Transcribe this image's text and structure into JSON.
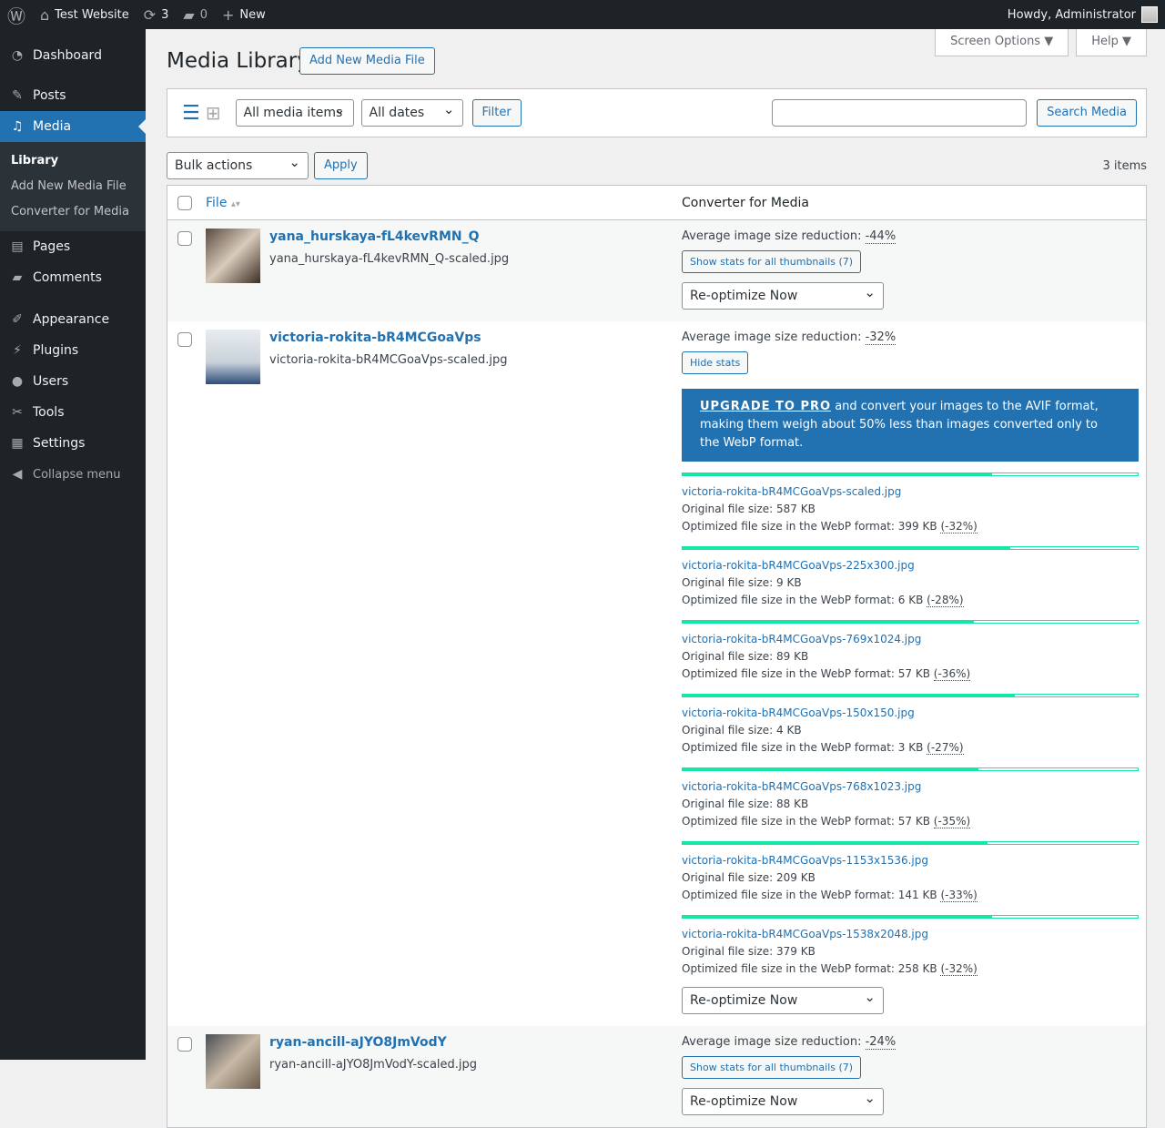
{
  "adminbar": {
    "site": "Test Website",
    "updates": "3",
    "comments": "0",
    "new": "New",
    "howdy": "Howdy, Administrator"
  },
  "menu": {
    "dashboard": "Dashboard",
    "posts": "Posts",
    "media": "Media",
    "sub": [
      "Library",
      "Add New Media File",
      "Converter for Media"
    ],
    "pages": "Pages",
    "comments": "Comments",
    "appearance": "Appearance",
    "plugins": "Plugins",
    "users": "Users",
    "tools": "Tools",
    "settings": "Settings",
    "collapse": "Collapse menu"
  },
  "header": {
    "title": "Media Library",
    "add_new": "Add New Media File",
    "screen_options": "Screen Options ▼",
    "help": "Help ▼"
  },
  "filters": {
    "type": "All media items",
    "dates": "All dates",
    "filter": "Filter",
    "search": "Search Media"
  },
  "bulk": {
    "label": "Bulk actions",
    "apply": "Apply",
    "count": "3 items"
  },
  "columns": {
    "file": "File",
    "converter": "Converter for Media"
  },
  "labels": {
    "avg": "Average image size reduction: ",
    "show": "Show stats for all thumbnails (7)",
    "hide": "Hide stats",
    "reopt": "Re-optimize Now",
    "orig": "Original file size: ",
    "opt": "Optimized file size in the WebP format: ",
    "promo_link": "UPGRADE TO PRO",
    "promo_text": " and convert your images to the AVIF format, making them weigh about 50% less than images converted only to the WebP format."
  },
  "rows": [
    {
      "title": "yana_hurskaya-fL4kevRMN_Q",
      "file": "yana_hurskaya-fL4kevRMN_Q-scaled.jpg",
      "avg": "-44%"
    },
    {
      "title": "victoria-rokita-bR4MCGoaVps",
      "file": "victoria-rokita-bR4MCGoaVps-scaled.jpg",
      "avg": "-32%"
    },
    {
      "title": "ryan-ancill-aJYO8JmVodY",
      "file": "ryan-ancill-aJYO8JmVodY-scaled.jpg",
      "avg": "-24%"
    }
  ],
  "stats": [
    {
      "name": "victoria-rokita-bR4MCGoaVps-scaled.jpg",
      "orig": "587 KB",
      "opt": "399 KB",
      "red": "(-32%)",
      "fill": 0.68
    },
    {
      "name": "victoria-rokita-bR4MCGoaVps-225x300.jpg",
      "orig": "9 KB",
      "opt": "6 KB",
      "red": "(-28%)",
      "fill": 0.72
    },
    {
      "name": "victoria-rokita-bR4MCGoaVps-769x1024.jpg",
      "orig": "89 KB",
      "opt": "57 KB",
      "red": "(-36%)",
      "fill": 0.64
    },
    {
      "name": "victoria-rokita-bR4MCGoaVps-150x150.jpg",
      "orig": "4 KB",
      "opt": "3 KB",
      "red": "(-27%)",
      "fill": 0.73
    },
    {
      "name": "victoria-rokita-bR4MCGoaVps-768x1023.jpg",
      "orig": "88 KB",
      "opt": "57 KB",
      "red": "(-35%)",
      "fill": 0.65
    },
    {
      "name": "victoria-rokita-bR4MCGoaVps-1153x1536.jpg",
      "orig": "209 KB",
      "opt": "141 KB",
      "red": "(-33%)",
      "fill": 0.67
    },
    {
      "name": "victoria-rokita-bR4MCGoaVps-1538x2048.jpg",
      "orig": "379 KB",
      "opt": "258 KB",
      "red": "(-32%)",
      "fill": 0.68
    }
  ]
}
